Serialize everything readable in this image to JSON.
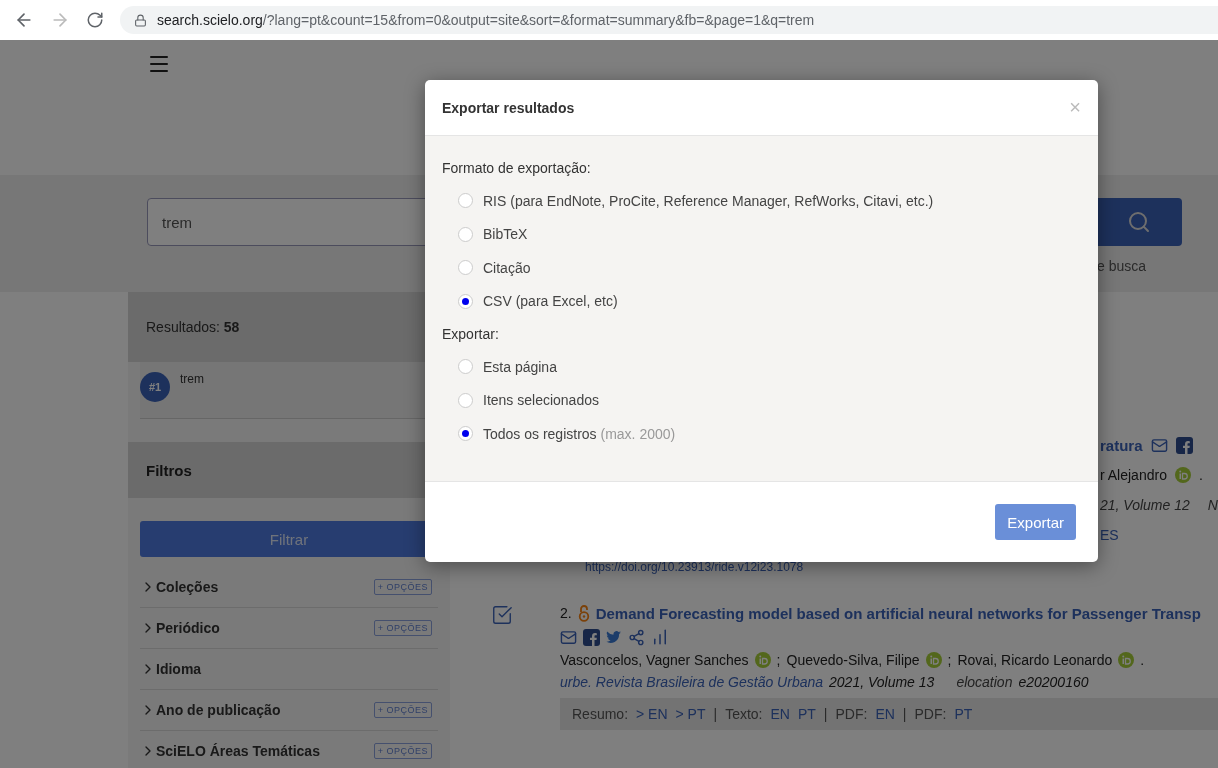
{
  "browser": {
    "host": "search.scielo.org",
    "path": "/?lang=pt&count=15&from=0&output=site&sort=&format=summary&fb=&page=1&q=trem"
  },
  "search": {
    "value": "trem",
    "hint_fragment": "e busca"
  },
  "results": {
    "label": "Resultados:",
    "count": "58"
  },
  "history": [
    {
      "badge": "#1",
      "query": "trem"
    }
  ],
  "filters": {
    "title": "Filtros",
    "button": "Filtrar",
    "items": [
      {
        "label": "Coleções",
        "options": "+ OPÇÕES"
      },
      {
        "label": "Periódico",
        "options": "+ OPÇÕES"
      },
      {
        "label": "Idioma"
      },
      {
        "label": "Ano de publicação",
        "options": "+ OPÇÕES"
      },
      {
        "label": "SciELO Áreas Temáticas",
        "options": "+ OPÇÕES"
      }
    ]
  },
  "hidden_item": {
    "title_fragment": "ratura",
    "authors_fragment": "r Alejandro",
    "authors_end": ".",
    "source_fragment": "21, Volume 12",
    "source_extra": "N",
    "links_fragment": "ES",
    "doi": "https://doi.org/10.23913/ride.v12i23.1078"
  },
  "item": {
    "checked": true,
    "number": "2.",
    "title": "Demand Forecasting model based on artificial neural networks for Passenger Transp",
    "authors": [
      {
        "name": "Vasconcelos, Vagner Sanches",
        "after": ";"
      },
      {
        "name": "Quevedo-Silva, Filipe",
        "after": ";"
      },
      {
        "name": "Rovai, Ricardo Leonardo",
        "after": "."
      }
    ],
    "journal": "urbe. Revista Brasileira de Gestão Urbana",
    "year_volume": "2021, Volume 13",
    "elocation_label": "elocation",
    "elocation": "e20200160",
    "links": [
      {
        "label": "Resumo:",
        "values": [
          "> EN",
          "> PT"
        ]
      },
      {
        "before": "|",
        "label": "Texto:",
        "values": [
          "EN",
          "PT"
        ]
      },
      {
        "before": "|",
        "label": "PDF:",
        "values": [
          "EN"
        ]
      },
      {
        "before": "|",
        "label": "PDF:",
        "values": [
          "PT"
        ]
      }
    ]
  },
  "modal": {
    "title": "Exportar resultados",
    "close": "×",
    "groups": [
      {
        "label": "Formato de exportação:",
        "options": [
          {
            "label": "RIS (para EndNote, ProCite, Reference Manager, RefWorks, Citavi, etc.)",
            "selected": false
          },
          {
            "label": "BibTeX",
            "selected": false
          },
          {
            "label": "Citação",
            "selected": false
          },
          {
            "label": "CSV (para Excel, etc)",
            "selected": true
          }
        ]
      },
      {
        "label": "Exportar:",
        "options": [
          {
            "label": "Esta página",
            "selected": false
          },
          {
            "label": "Itens selecionados",
            "selected": false
          },
          {
            "label": "Todos os registros",
            "note": "(max. 2000)",
            "selected": true
          }
        ]
      }
    ],
    "button": "Exportar"
  }
}
